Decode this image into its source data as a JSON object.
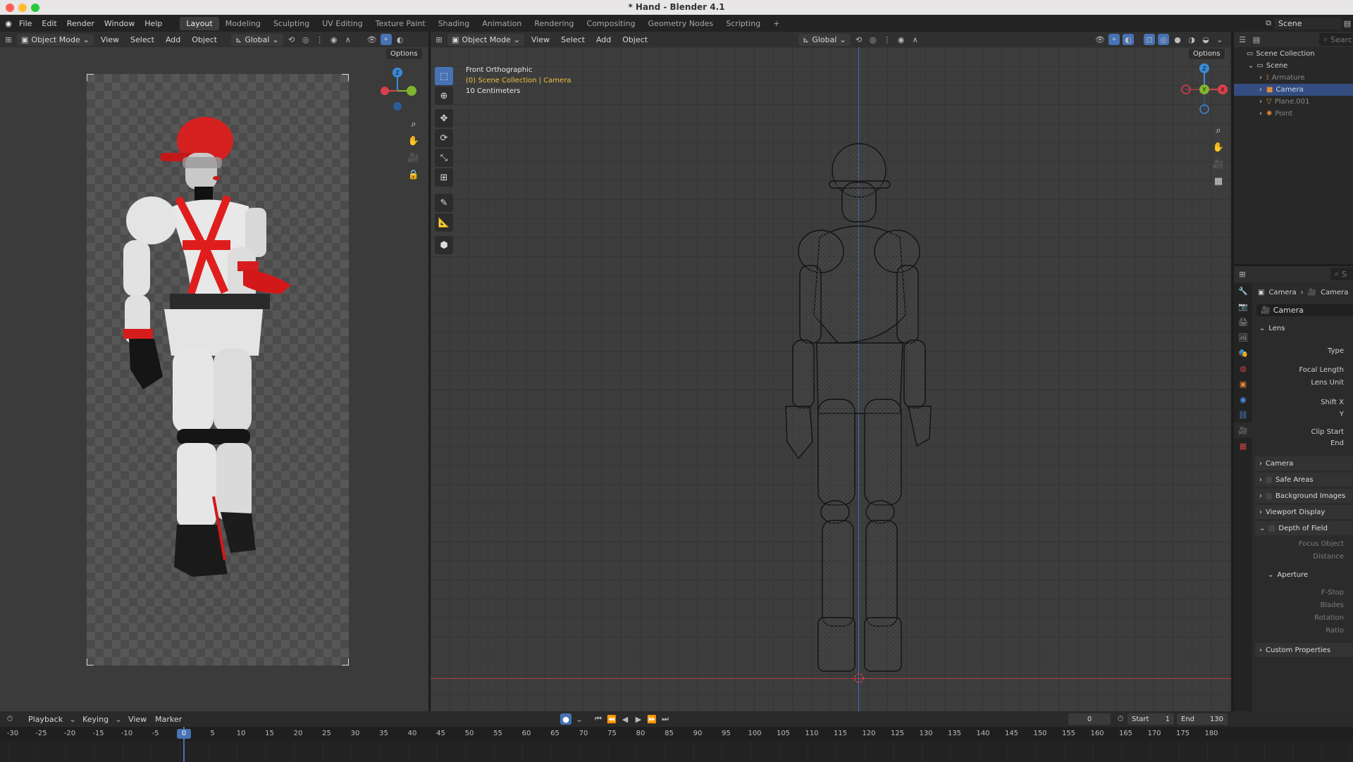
{
  "window": {
    "title": "* Hand - Blender 4.1"
  },
  "menubar": {
    "items": [
      "File",
      "Edit",
      "Render",
      "Window",
      "Help"
    ],
    "workspace_tabs": [
      "Layout",
      "Modeling",
      "Sculpting",
      "UV Editing",
      "Texture Paint",
      "Shading",
      "Animation",
      "Rendering",
      "Compositing",
      "Geometry Nodes",
      "Scripting"
    ],
    "active_tab": "Layout",
    "add_tab": "+",
    "scene_label": "Scene"
  },
  "viewport_left": {
    "mode": "Object Mode",
    "menus": [
      "View",
      "Select",
      "Add",
      "Object"
    ],
    "orientation": "Global",
    "options": "Options"
  },
  "viewport_right": {
    "mode": "Object Mode",
    "menus": [
      "View",
      "Select",
      "Add",
      "Object"
    ],
    "orientation": "Global",
    "options": "Options",
    "overlay_view": "Front Orthographic",
    "overlay_collection": "(0) Scene Collection | Camera",
    "overlay_scale": "10 Centimeters"
  },
  "gizmo": {
    "z": "Z",
    "y": "Y",
    "x": "X"
  },
  "outliner": {
    "search_placeholder": "Search",
    "root": "Scene Collection",
    "scene": "Scene",
    "items": [
      {
        "name": "Armature",
        "icon": "armature-icon",
        "color": "#e0893a"
      },
      {
        "name": "Camera",
        "icon": "camera-icon",
        "color": "#e0893a"
      },
      {
        "name": "Plane.001",
        "icon": "mesh-icon",
        "color": "#e0893a"
      },
      {
        "name": "Point",
        "icon": "light-icon",
        "color": "#e0893a"
      }
    ],
    "selected": "Camera"
  },
  "properties": {
    "search_placeholder": "Search",
    "breadcrumb": [
      "Camera",
      "Camera"
    ],
    "datablock": "Camera",
    "lens_panel": "Lens",
    "fields": {
      "type": "Type",
      "focal_length": "Focal Length",
      "lens_unit": "Lens Unit",
      "shift_x": "Shift X",
      "shift_y": "Y",
      "clip_start": "Clip Start",
      "clip_end": "End"
    },
    "panels": [
      "Camera",
      "Safe Areas",
      "Background Images",
      "Viewport Display",
      "Depth of Field"
    ],
    "dof_fields": {
      "focus_object": "Focus Object",
      "distance": "Distance"
    },
    "aperture_panel": "Aperture",
    "aperture_fields": [
      "F-Stop",
      "Blades",
      "Rotation",
      "Ratio"
    ],
    "custom_properties": "Custom Properties"
  },
  "timeline": {
    "menus": [
      "Playback",
      "Keying",
      "View",
      "Marker"
    ],
    "current_frame": "0",
    "start_label": "Start",
    "start_value": "1",
    "end_label": "End",
    "end_value": "130",
    "ticks": [
      "-30",
      "-25",
      "-20",
      "-15",
      "-10",
      "-5",
      "0",
      "5",
      "10",
      "15",
      "20",
      "25",
      "30",
      "35",
      "40",
      "45",
      "50",
      "55",
      "60",
      "65",
      "70",
      "75",
      "80",
      "85",
      "90",
      "95",
      "100",
      "105",
      "110",
      "115",
      "120",
      "125",
      "130",
      "135",
      "140",
      "145",
      "150",
      "155",
      "160",
      "165",
      "170",
      "175",
      "180"
    ]
  },
  "colors": {
    "accent": "#4772b3",
    "x_axis": "#d9404a",
    "y_axis": "#7fb530",
    "z_axis": "#3b8ad8",
    "selection": "#334d80",
    "active_text": "#f0c23a"
  }
}
